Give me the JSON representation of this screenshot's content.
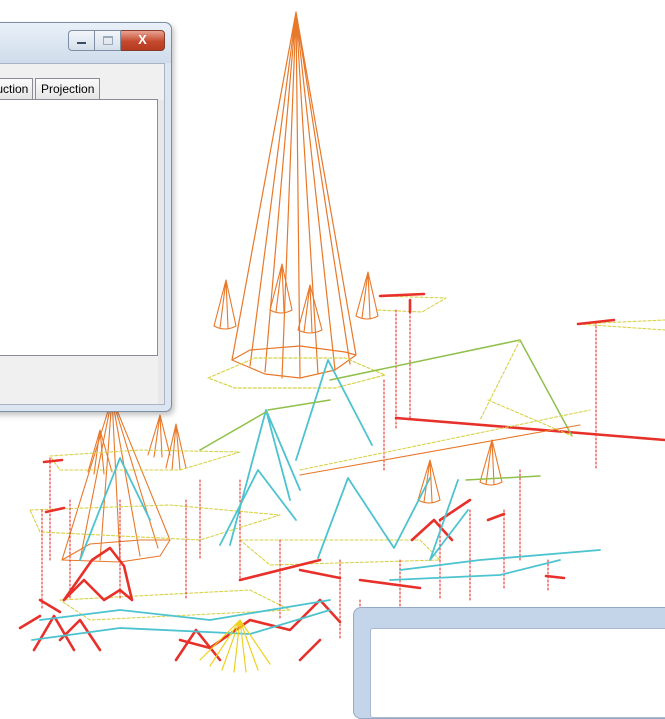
{
  "dialog": {
    "tabs": [
      {
        "label": "truction"
      },
      {
        "label": "Projection"
      }
    ],
    "close_glyph": "X",
    "icons": [
      "minimize-icon",
      "maximize-icon",
      "close-icon"
    ]
  },
  "scene": {
    "colors": {
      "cone": "#e8782a",
      "footprint": "#d8d24a",
      "wall_edge": "#e8302a",
      "roof": "#4cc3cf",
      "ridge": "#8fc04a",
      "highlight_cone": "#f0d020"
    }
  }
}
